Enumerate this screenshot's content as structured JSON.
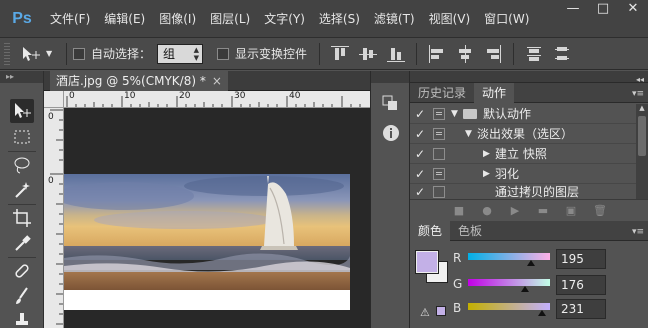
{
  "app": {
    "logo": "Ps"
  },
  "menu": [
    "文件(F)",
    "编辑(E)",
    "图像(I)",
    "图层(L)",
    "文字(Y)",
    "选择(S)",
    "滤镜(T)",
    "视图(V)",
    "窗口(W)"
  ],
  "window_controls": {
    "minimize": "—",
    "maximize": "□",
    "close": "✕"
  },
  "options_bar": {
    "auto_select_label": "自动选择：",
    "auto_select_value": "组",
    "show_transform_label": "显示变换控件"
  },
  "document": {
    "tab_title": "酒店.jpg @ 5%(CMYK/8) *",
    "tab_close": "×",
    "ruler_h": [
      "0",
      "10",
      "20",
      "30",
      "40"
    ],
    "ruler_v": [
      "0",
      "0"
    ]
  },
  "actions_panel": {
    "tabs": [
      "历史记录",
      "动作"
    ],
    "active_tab": "动作",
    "rows": [
      {
        "check": "✓",
        "dialog": true,
        "expanded": true,
        "indent": 0,
        "folder": true,
        "label": "默认动作"
      },
      {
        "check": "✓",
        "dialog": true,
        "expanded": true,
        "indent": 1,
        "folder": false,
        "label": "淡出效果（选区）"
      },
      {
        "check": "✓",
        "dialog": false,
        "expanded": false,
        "indent": 2,
        "folder": false,
        "label": "建立 快照"
      },
      {
        "check": "✓",
        "dialog": true,
        "expanded": false,
        "indent": 2,
        "folder": false,
        "label": "羽化"
      },
      {
        "check": "✓",
        "dialog": false,
        "expanded": null,
        "indent": 2,
        "folder": false,
        "label": "通过拷贝的图层"
      }
    ]
  },
  "color_panel": {
    "tabs": [
      "颜色",
      "色板"
    ],
    "active_tab": "颜色",
    "foreground_color": "#C3B0E7",
    "background_color": "#F0F0F0",
    "channels": [
      {
        "label": "R",
        "value": "195",
        "level": 0.765,
        "gradient": "linear-gradient(90deg,#00b0e7,#ffb0e7)"
      },
      {
        "label": "G",
        "value": "176",
        "level": 0.69,
        "gradient": "linear-gradient(90deg,#c300e7,#c3ffe7)"
      },
      {
        "label": "B",
        "value": "231",
        "level": 0.906,
        "gradient": "linear-gradient(90deg,#c3b000,#c3b0ff)"
      }
    ]
  }
}
